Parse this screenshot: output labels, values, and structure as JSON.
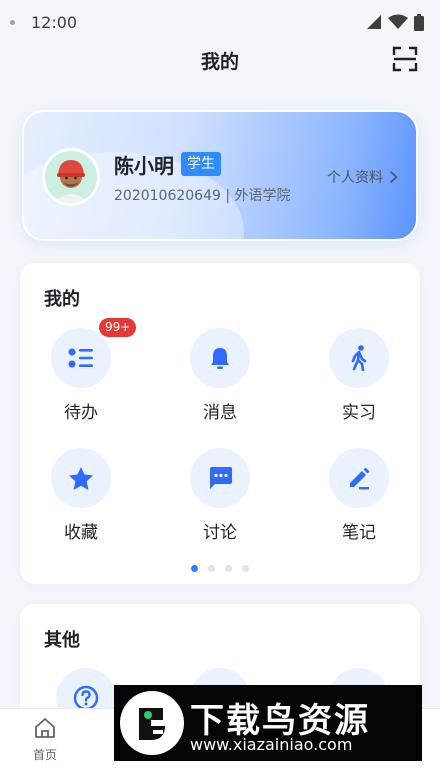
{
  "status_bar": {
    "time": "12:00"
  },
  "header": {
    "title": "我的"
  },
  "profile": {
    "name": "陈小明",
    "role": "学生",
    "info": "202010620649 | 外语学院",
    "link_label": "个人资料"
  },
  "mine": {
    "title": "我的",
    "items": [
      {
        "label": "待办",
        "icon": "todo-list-icon",
        "badge": "99+"
      },
      {
        "label": "消息",
        "icon": "bell-icon"
      },
      {
        "label": "实习",
        "icon": "walking-person-icon"
      },
      {
        "label": "收藏",
        "icon": "star-icon"
      },
      {
        "label": "讨论",
        "icon": "chat-bubble-icon"
      },
      {
        "label": "笔记",
        "icon": "pencil-icon"
      }
    ],
    "page_count": 4,
    "active_page": 1
  },
  "other": {
    "title": "其他",
    "items": [
      {
        "icon": "help-question-icon"
      }
    ]
  },
  "tabbar": {
    "home_label": "首页"
  },
  "watermark": {
    "title": "下载鸟资源",
    "url": "www.xiazainiao.com"
  },
  "colors": {
    "accent": "#2f7bff",
    "badge": "#e53935",
    "icon_bg": "#eaf2ff"
  }
}
